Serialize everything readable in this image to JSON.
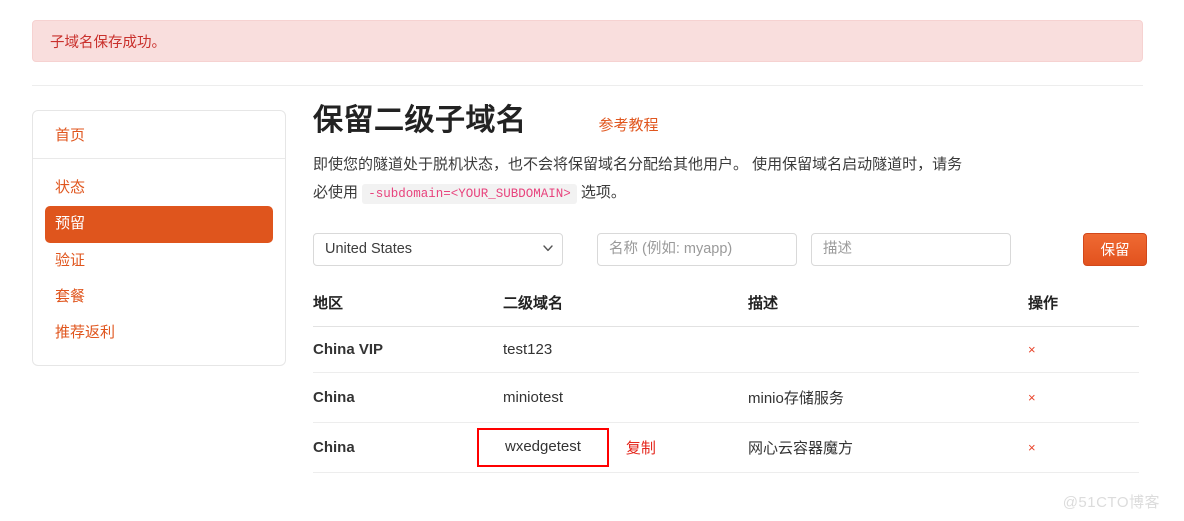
{
  "alert": {
    "message": "子域名保存成功。",
    "bg_color": "#f9dedd",
    "text_color": "#c9302c"
  },
  "sidebar": {
    "home_label": "首页",
    "items": [
      {
        "label": "状态",
        "active": false
      },
      {
        "label": "预留",
        "active": true
      },
      {
        "label": "验证",
        "active": false
      },
      {
        "label": "套餐",
        "active": false
      },
      {
        "label": "推荐返利",
        "active": false
      }
    ],
    "accent_color": "#e0561e",
    "active_bg": "#df551d"
  },
  "main": {
    "title": "保留二级子域名",
    "tutorial_link": "参考教程",
    "description_part1": "即使您的隧道处于脱机状态，也不会将保留域名分配给其他用户。 使用保留域名启动隧道时，请务必使用",
    "code_snippet": "-subdomain=<YOUR_SUBDOMAIN>",
    "description_part2": "选项。"
  },
  "form": {
    "region_selected": "United States",
    "region_options": [
      "United States"
    ],
    "name_placeholder": "名称 (例如: myapp)",
    "name_value": "",
    "desc_placeholder": "描述",
    "desc_value": "",
    "submit_label": "保留",
    "dropdown_icon": "chevron-down-icon",
    "submit_color": "#e2521e"
  },
  "table": {
    "headers": [
      "地区",
      "二级域名",
      "描述",
      "操作"
    ],
    "delete_icon": "×",
    "copy_label": "复制",
    "rows": [
      {
        "region": "China VIP",
        "domain": "test123",
        "description": "",
        "highlighted": false,
        "has_copy": false
      },
      {
        "region": "China",
        "domain": "miniotest",
        "description": "minio存储服务",
        "highlighted": false,
        "has_copy": false
      },
      {
        "region": "China",
        "domain": "wxedgetest",
        "description": "网心云容器魔方",
        "highlighted": true,
        "has_copy": true
      }
    ],
    "highlight_color": "#ff0000"
  },
  "watermark": "@51CTO博客"
}
